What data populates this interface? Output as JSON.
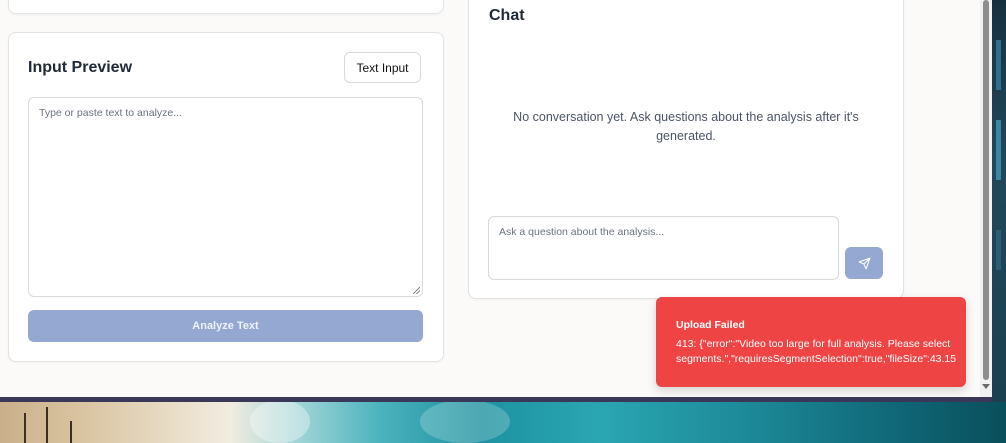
{
  "input_preview": {
    "title": "Input Preview",
    "mode_button": "Text Input",
    "textarea_placeholder": "Type or paste text to analyze...",
    "analyze_button": "Analyze Text"
  },
  "chat": {
    "title": "Chat",
    "empty_message": "No conversation yet. Ask questions about the analysis after it's generated.",
    "input_placeholder": "Ask a question about the analysis...",
    "send_icon": "send-icon"
  },
  "toast": {
    "title": "Upload Failed",
    "message": "413: {\"error\":\"Video too large for full analysis. Please select segments.\",\"requiresSegmentSelection\":true,\"fileSize\":43.15",
    "color": "#ef4444"
  },
  "colors": {
    "primary_disabled": "#95a8d1",
    "window_bg": "#fbfaf8"
  }
}
